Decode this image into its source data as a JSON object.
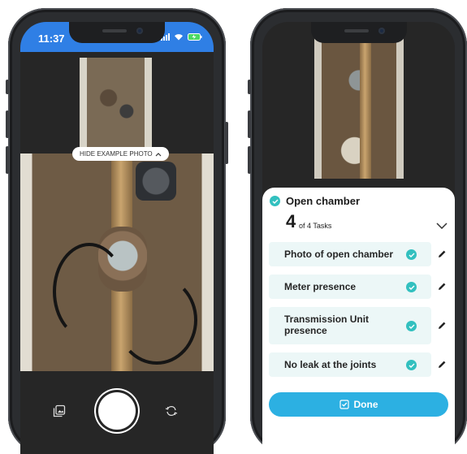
{
  "left_phone": {
    "status_bar": {
      "time": "11:37",
      "icons": [
        "signal-icon",
        "wifi-icon",
        "battery-icon"
      ]
    },
    "hide_example_label": "HIDE EXAMPLE PHOTO",
    "controls": {
      "gallery_icon": "gallery-icon",
      "shutter": "shutter-button",
      "flip_icon": "flip-camera-icon"
    }
  },
  "right_phone": {
    "section_title": "Open chamber",
    "tasks_done": "4",
    "tasks_total_label": "of 4 Tasks",
    "tasks": [
      {
        "label": "Photo of open chamber"
      },
      {
        "label": "Meter presence"
      },
      {
        "label": "Transmission Unit presence"
      },
      {
        "label": "No leak at the joints"
      }
    ],
    "done_label": "Done"
  },
  "colors": {
    "accent_blue": "#2f7fe5",
    "teal_check": "#32c0bf",
    "task_bg": "#ecf7f7",
    "done_button": "#2cb0e2"
  }
}
